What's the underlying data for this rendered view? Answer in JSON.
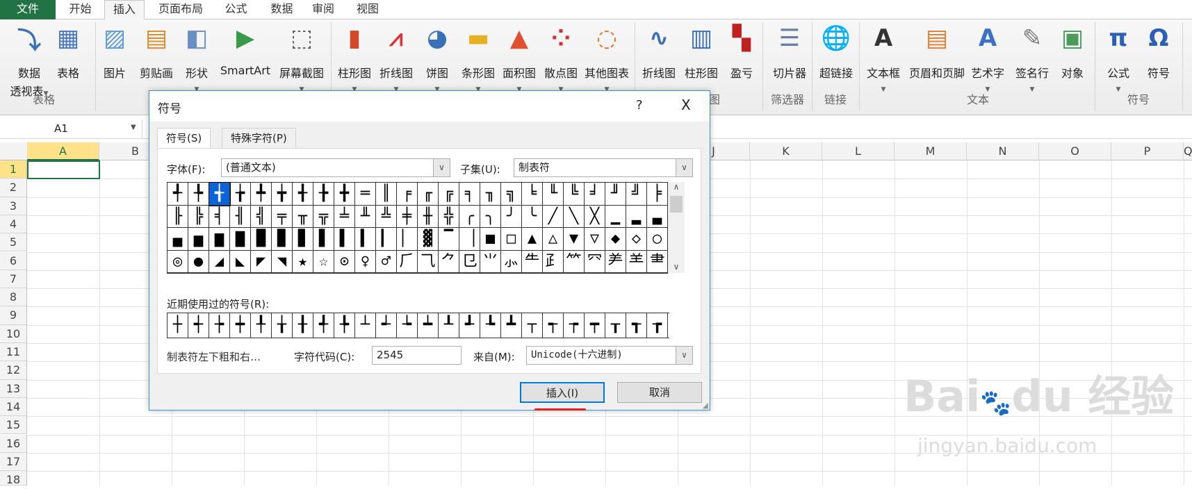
{
  "ribbon_tabs": [
    "文件",
    "开始",
    "插入",
    "页面布局",
    "公式",
    "数据",
    "审阅",
    "视图"
  ],
  "active_tab": "插入",
  "ribbon_items": [
    {
      "label": "数据",
      "label2": "透视表",
      "icon": "pivot-table-icon",
      "glyph": "⤵",
      "color": "#3b6fb6",
      "arrow": true
    },
    {
      "label": "表格",
      "icon": "table-icon",
      "glyph": "▦",
      "color": "#4a78c0"
    },
    {
      "label": "图片",
      "icon": "picture-icon",
      "glyph": "▨",
      "color": "#5b9bd5"
    },
    {
      "label": "剪贴画",
      "icon": "clipart-icon",
      "glyph": "▤",
      "color": "#d98b2b"
    },
    {
      "label": "形状",
      "icon": "shapes-icon",
      "glyph": "◧",
      "color": "#6a8fc8",
      "arrow": true
    },
    {
      "label": "SmartArt",
      "icon": "smartart-icon",
      "glyph": "▶",
      "color": "#3a9a4a"
    },
    {
      "label": "屏幕截图",
      "icon": "screenshot-icon",
      "glyph": "⬚",
      "color": "#555",
      "arrow": true
    },
    {
      "label": "柱形图",
      "icon": "column-chart-icon",
      "glyph": "▮",
      "color": "#d04a2a",
      "arrow": true
    },
    {
      "label": "折线图",
      "icon": "line-chart-icon",
      "glyph": "⩘",
      "color": "#d33",
      "arrow": true
    },
    {
      "label": "饼图",
      "icon": "pie-chart-icon",
      "glyph": "◕",
      "color": "#3a70b8",
      "arrow": true
    },
    {
      "label": "条形图",
      "icon": "bar-chart-icon",
      "glyph": "▬",
      "color": "#e6b020",
      "arrow": true
    },
    {
      "label": "面积图",
      "icon": "area-chart-icon",
      "glyph": "▲",
      "color": "#e05030",
      "arrow": true
    },
    {
      "label": "散点图",
      "icon": "scatter-chart-icon",
      "glyph": "⁘",
      "color": "#c33",
      "arrow": true
    },
    {
      "label": "其他图表",
      "icon": "other-charts-icon",
      "glyph": "◌",
      "color": "#e07020",
      "arrow": true
    },
    {
      "label": "折线图",
      "icon": "sparkline-line-icon",
      "glyph": "∿",
      "color": "#3a70b8"
    },
    {
      "label": "柱形图",
      "icon": "sparkline-column-icon",
      "glyph": "▥",
      "color": "#3a70b8"
    },
    {
      "label": "盈亏",
      "icon": "sparkline-winloss-icon",
      "glyph": "▚",
      "color": "#c02020"
    },
    {
      "label": "切片器",
      "icon": "slicer-icon",
      "glyph": "☰",
      "color": "#6b7fa0"
    },
    {
      "label": "超链接",
      "icon": "hyperlink-globe-icon",
      "glyph": "🌐",
      "color": "#2a8a3a"
    },
    {
      "label": "文本框",
      "icon": "textbox-icon",
      "glyph": "A",
      "color": "#333",
      "arrow": true
    },
    {
      "label": "页眉和页脚",
      "icon": "header-footer-icon",
      "glyph": "▤",
      "color": "#e08030"
    },
    {
      "label": "艺术字",
      "icon": "wordart-icon",
      "glyph": "A",
      "color": "#3a70c8",
      "arrow": true
    },
    {
      "label": "签名行",
      "icon": "signature-line-icon",
      "glyph": "✎",
      "color": "#777",
      "arrow": true
    },
    {
      "label": "对象",
      "icon": "object-icon",
      "glyph": "▣",
      "color": "#4a9a5a"
    },
    {
      "label": "公式",
      "icon": "equation-pi-icon",
      "glyph": "π",
      "color": "#2a60b8",
      "arrow": true
    },
    {
      "label": "符号",
      "icon": "symbol-omega-icon",
      "glyph": "Ω",
      "color": "#2a60b8"
    }
  ],
  "ribbon_groups": [
    "表格",
    "图",
    "筛选器",
    "链接",
    "文本",
    "符号"
  ],
  "name_box": "A1",
  "columns": [
    "A",
    "B",
    "C",
    "D",
    "E",
    "F",
    "G",
    "H",
    "I",
    "J",
    "K",
    "L",
    "M",
    "N",
    "O",
    "P",
    "Q"
  ],
  "rows": [
    "1",
    "2",
    "3",
    "4",
    "5",
    "6",
    "7",
    "8",
    "9",
    "10",
    "11",
    "12",
    "13",
    "14",
    "15",
    "16",
    "17",
    "18"
  ],
  "dialog": {
    "title": "符号",
    "help": "?",
    "close": "X",
    "tabs": [
      "符号(S)",
      "特殊字符(P)"
    ],
    "font_label": "字体(F):",
    "font_value": "(普通文本)",
    "subset_label": "子集(U):",
    "subset_value": "制表符",
    "symbols": [
      "╃",
      "╄",
      "╅",
      "╆",
      "╇",
      "╈",
      "╉",
      "╊",
      "╋",
      "═",
      "║",
      "╒",
      "╓",
      "╔",
      "╕",
      "╖",
      "╗",
      "╘",
      "╙",
      "╚",
      "╛",
      "╜",
      "╝",
      "╞",
      "╟",
      "╠",
      "╡",
      "╢",
      "╣",
      "╤",
      "╥",
      "╦",
      "╧",
      "╨",
      "╩",
      "╪",
      "╫",
      "╬",
      "╭",
      "╮",
      "╯",
      "╰",
      "╱",
      "╲",
      "╳",
      "▁",
      "▂",
      "▃",
      "▄",
      "▅",
      "▆",
      "▇",
      "█",
      "▉",
      "▊",
      "▋",
      "▌",
      "▍",
      "▎",
      "▏",
      "▓",
      "▔",
      "▕",
      "■",
      "□",
      "▲",
      "△",
      "▼",
      "▽",
      "◆",
      "◇",
      "○",
      "◎",
      "●",
      "◢",
      "◣",
      "◤",
      "◥",
      "★",
      "☆",
      "⊙",
      "♀",
      "♂",
      "⺁",
      "⺄",
      "⺈",
      "⺋",
      "⺌",
      "⺗",
      "⺧",
      "⺪",
      "⺮",
      "⺳",
      "⺶",
      "⺷",
      "⺻"
    ],
    "selected_symbol": "╅",
    "recent_label": "近期使用过的符号(R):",
    "recent": [
      "┼",
      "┽",
      "┾",
      "┿",
      "╀",
      "╁",
      "╂",
      "╃",
      "╄",
      "┴",
      "┵",
      "┶",
      "┷",
      "┸",
      "┹",
      "┺",
      "┻",
      "┬",
      "┭",
      "┮",
      "┯",
      "┰",
      "┱",
      "┲"
    ],
    "char_name": "制表符左下粗和右…",
    "code_label": "字符代码(C):",
    "code_value": "2545",
    "from_label": "来自(M):",
    "from_value": "Unicode(十六进制)",
    "insert": "插入(I)",
    "cancel": "取消"
  },
  "accent_colors": {
    "excel_green": "#217346",
    "dialog_border": "#3c8ee0",
    "annotation_red": "#e02020"
  },
  "watermark": {
    "logo": "Bai du 经验",
    "url": "jingyan.baidu.com"
  }
}
